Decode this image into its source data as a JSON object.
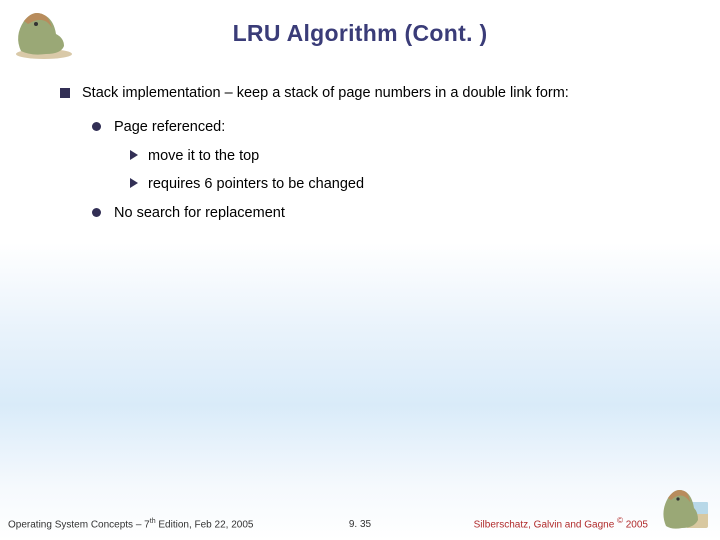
{
  "title": "LRU Algorithm (Cont. )",
  "bullets": {
    "b1": "Stack implementation – keep a stack of page numbers in a double link form:",
    "b1_1": "Page referenced:",
    "b1_1_a": "move it to the top",
    "b1_1_b": "requires 6 pointers to be changed",
    "b1_2": "No search for replacement"
  },
  "footer": {
    "left_pre": "Operating System Concepts – 7",
    "left_sup": "th",
    "left_post": " Edition, Feb 22, 2005",
    "center": "9. 35",
    "right_pre": "Silberschatz, Galvin and Gagne ",
    "right_copy": "©",
    "right_post": " 2005"
  }
}
